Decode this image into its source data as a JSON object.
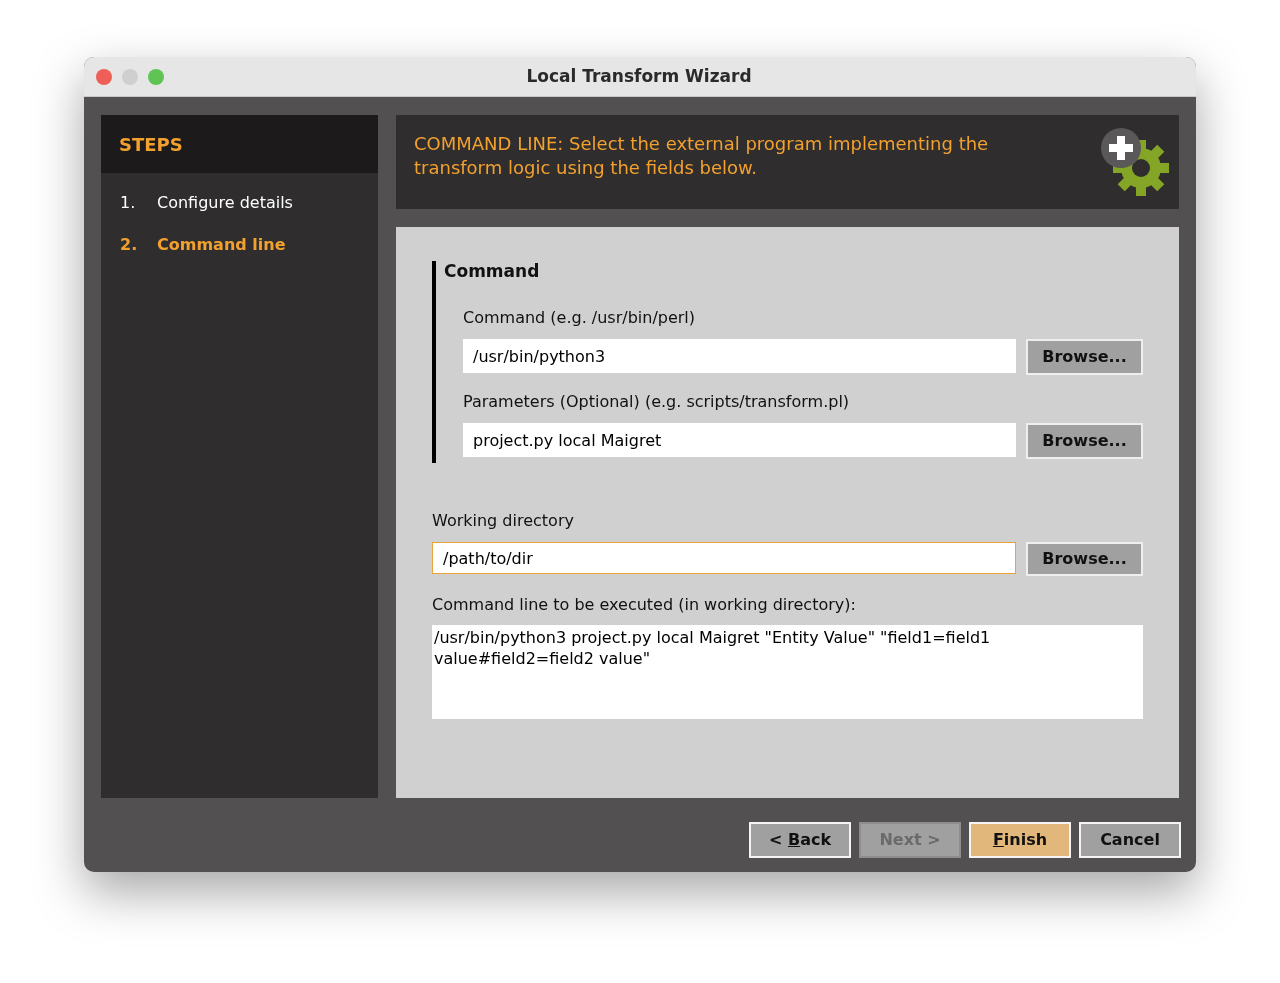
{
  "window": {
    "title": "Local Transform Wizard"
  },
  "sidebar": {
    "title": "STEPS",
    "steps": [
      {
        "number": "1.",
        "label": "Configure details",
        "selected": false
      },
      {
        "number": "2.",
        "label": "Command line",
        "selected": true
      }
    ]
  },
  "header": {
    "text": "COMMAND LINE: Select the external program implementing the transform logic using the fields below."
  },
  "command_section": {
    "title": "Command",
    "fields": [
      {
        "label": "Command (e.g. /usr/bin/perl)",
        "value": "/usr/bin/python3",
        "button": "Browse..."
      },
      {
        "label": "Parameters (Optional) (e.g. scripts/transform.pl)",
        "value": "project.py local Maigret",
        "button": "Browse..."
      }
    ]
  },
  "working_directory": {
    "label": "Working directory",
    "value": "/path/to/dir",
    "focused": true,
    "button": "Browse..."
  },
  "command_preview": {
    "label": "Command line to be executed (in working directory):",
    "value": "/usr/bin/python3 project.py local Maigret \"Entity Value\" \"field1=field1 value#field2=field2 value\""
  },
  "buttons": [
    {
      "before": "< ",
      "mnemonic": "B",
      "after": "ack",
      "kind": "normal",
      "disabled": false
    },
    {
      "before": "Next >",
      "kind": "normal",
      "disabled": true
    },
    {
      "mnemonic": "F",
      "after": "inish",
      "kind": "default",
      "disabled": false
    },
    {
      "before": "Cancel",
      "kind": "normal",
      "disabled": false
    }
  ]
}
